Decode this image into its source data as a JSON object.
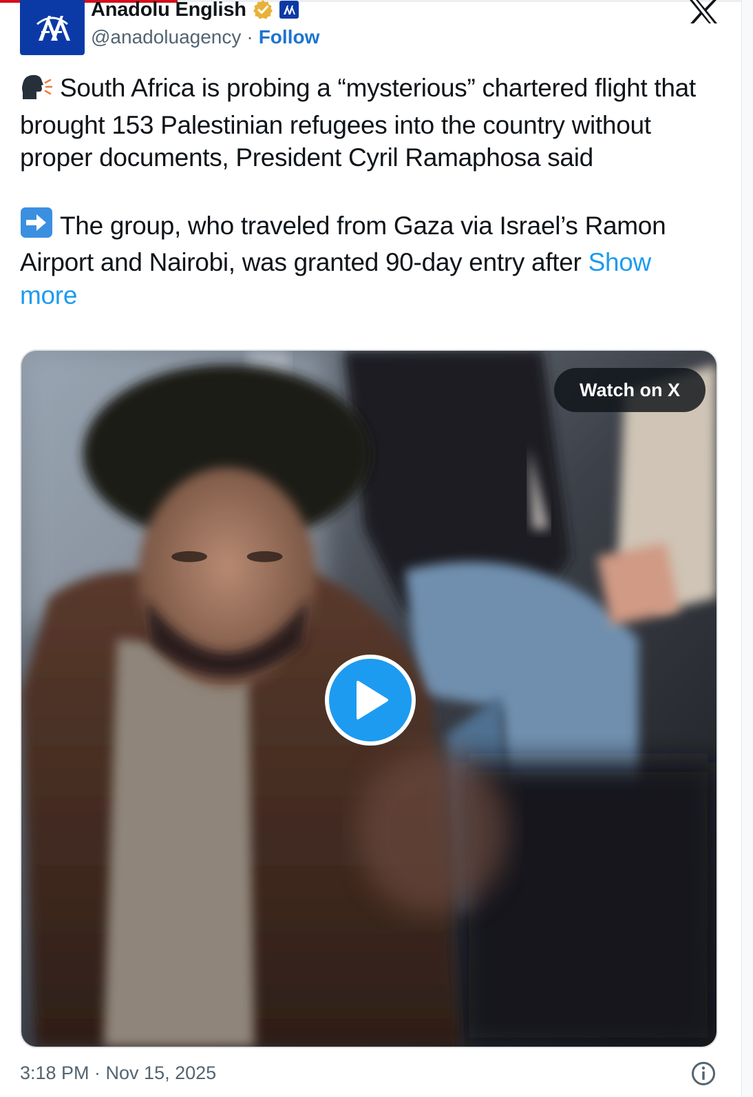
{
  "header": {
    "display_name": "Anadolu English",
    "handle": "@anadoluagency",
    "separator": "·",
    "follow_label": "Follow",
    "avatar_icon": "aa-logo-icon",
    "verified_icon": "gold-verified-badge-icon",
    "affiliation_icon": "aa-affiliate-badge-icon",
    "close_icon": "x-logo-icon"
  },
  "tweet": {
    "para1_emoji": "🗣️",
    "para1_text": "South Africa is probing a “mysterious” chartered flight that brought 153 Palestinian refugees into the country without proper documents, President Cyril Ramaphosa said",
    "para2_emoji": "➡️",
    "para2_text": "The group, who traveled from Gaza via Israel’s Ramon Airport and Nairobi, was granted 90-day entry after",
    "show_more_label": "Show more"
  },
  "media": {
    "watch_label": "Watch on X",
    "play_icon": "play-icon"
  },
  "footer": {
    "timestamp": "3:18 PM · Nov 15, 2025",
    "info_icon": "info-icon"
  },
  "colors": {
    "brand_blue": "#0b3aa7",
    "link_blue": "#1d9bf0",
    "follow_blue": "#1d74d0",
    "verified_gold": "#e8b23a",
    "accent_red": "#d4101c",
    "muted_text": "#536471"
  }
}
